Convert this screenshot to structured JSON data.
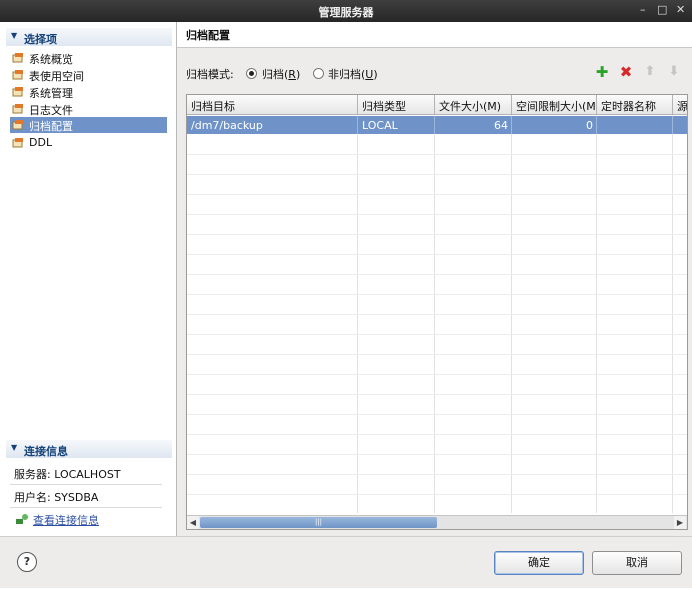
{
  "window": {
    "title": "管理服务器"
  },
  "sidebar": {
    "options_header": "选择项",
    "items": [
      {
        "label": "系统概览"
      },
      {
        "label": "表使用空间"
      },
      {
        "label": "系统管理"
      },
      {
        "label": "日志文件"
      },
      {
        "label": "归档配置",
        "selected": true
      },
      {
        "label": "DDL"
      }
    ],
    "connection_header": "连接信息",
    "server_line": "服务器: LOCALHOST",
    "user_line": "用户名: SYSDBA",
    "view_link": "查看连接信息"
  },
  "main": {
    "title": "归档配置",
    "mode_label": "归档模式:",
    "mode_archive": "归档(R)",
    "mode_archive_key": "R",
    "mode_noarchive": "非归档(U)",
    "mode_noarchive_key": "U",
    "selected_mode": "archive",
    "toolbar_icons": [
      "add-icon",
      "delete-icon",
      "move-up-icon",
      "move-down-icon"
    ],
    "columns": [
      "归档目标",
      "归档类型",
      "文件大小(M)",
      "空间限制大小(M",
      "定时器名称",
      "源"
    ],
    "rows": [
      {
        "target": "/dm7/backup",
        "type": "LOCAL",
        "file_size": "64",
        "space_limit": "0",
        "timer": "",
        "source": ""
      }
    ]
  },
  "footer": {
    "ok_label": "确定",
    "cancel_label": "取消"
  },
  "colors": {
    "selection": "#6f93c9",
    "add_icon": "#2ba32b",
    "delete_icon": "#d62a2a",
    "link": "#2b4fa3"
  }
}
